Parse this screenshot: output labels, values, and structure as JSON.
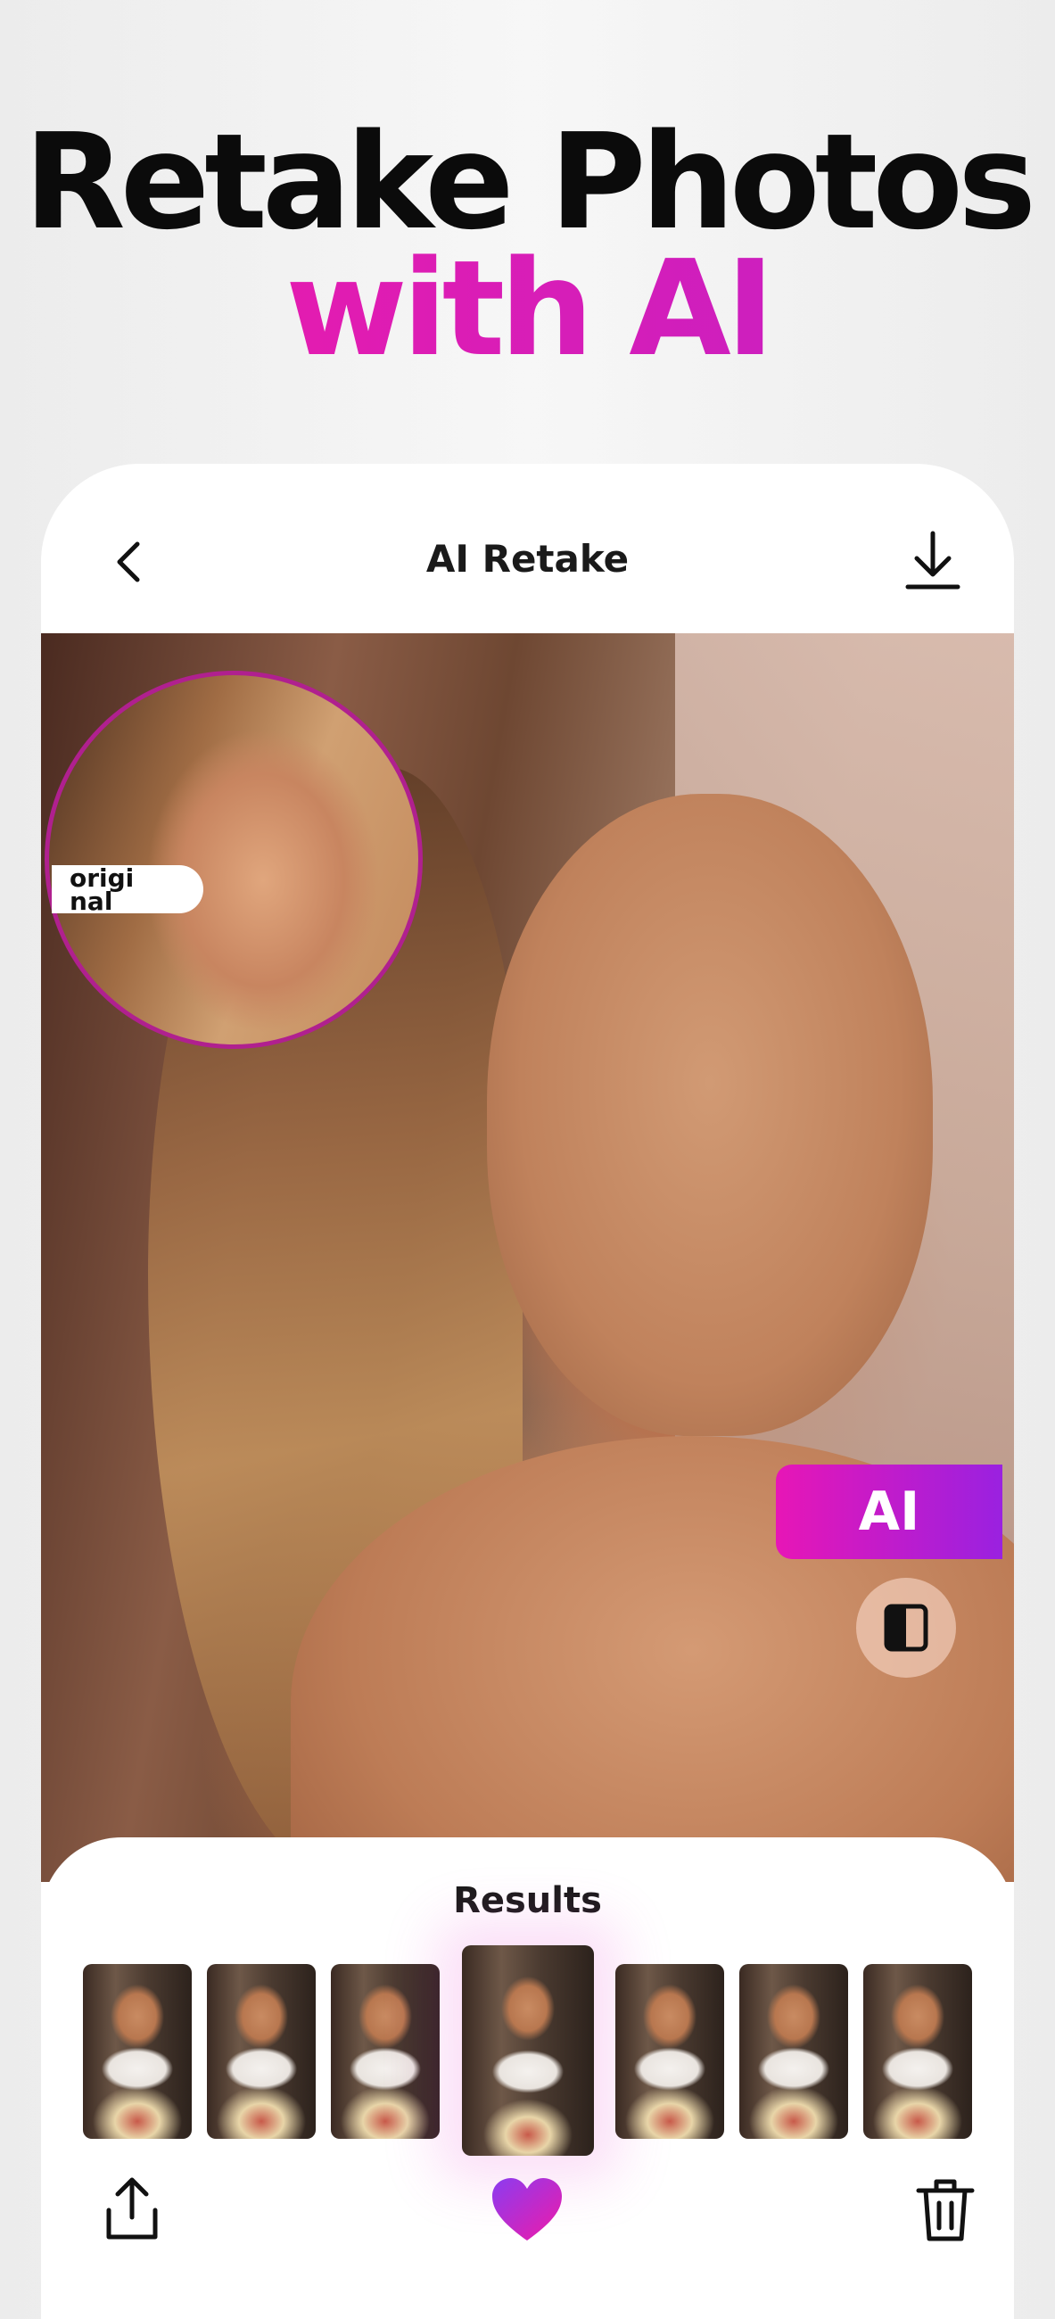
{
  "headline": {
    "line1": "Retake Photos",
    "line2": "with AI"
  },
  "topbar": {
    "title": "AI Retake"
  },
  "photo": {
    "original_label": "original",
    "ai_badge": "AI"
  },
  "results": {
    "title": "Results",
    "thumbnail_count": 7,
    "selected_index": 3
  },
  "icons": {
    "back": "chevron-left-icon",
    "download": "download-icon",
    "compare": "split-compare-icon",
    "share": "share-icon",
    "favorite": "heart-icon",
    "delete": "trash-icon"
  },
  "colors": {
    "accent_pink": "#f01aa8",
    "accent_purple": "#9a21e0",
    "ring": "#b0208f"
  }
}
